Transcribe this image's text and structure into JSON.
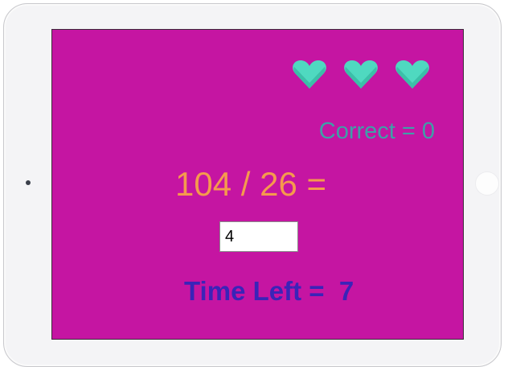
{
  "game": {
    "lives": 3,
    "lives_icon": "heart-icon",
    "score_text": "Correct = 0",
    "question_text": "104 / 26 =",
    "answer_value": "4",
    "timer_label": "Time Left =",
    "timer_value": "7"
  },
  "colors": {
    "screen_background": "#c515a2",
    "heart": "#4fd9c0",
    "score_text": "#3ea0a8",
    "question_text": "#f59a4d",
    "timer_text": "#3a24b8"
  }
}
